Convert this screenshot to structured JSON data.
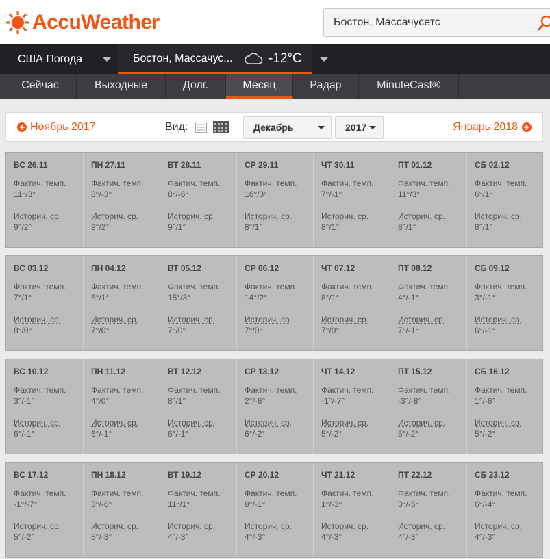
{
  "brand": {
    "name": "AccuWeather",
    "color": "#f05514"
  },
  "search": {
    "value": "Бостон, Массачусетс"
  },
  "nav": {
    "country": "США Погода",
    "city": "Бостон, Массачус...",
    "temp": "-12°C",
    "tabs": [
      "Сейчас",
      "Выходные",
      "Долг.",
      "Месяц",
      "Радар",
      "MinuteCast®"
    ],
    "active_tab": "Месяц"
  },
  "month": {
    "prev": "Ноябрь 2017",
    "next": "Январь 2018",
    "view_label": "Вид:",
    "month_select": "Декабрь",
    "year_select": "2017"
  },
  "labels": {
    "actual": "Фактич. темп.",
    "historic": "Историч. ср."
  },
  "weeks": [
    [
      {
        "d": "ВС 26.11",
        "a": "11°/3°",
        "h": "9°/2°"
      },
      {
        "d": "ПН 27.11",
        "a": "8°/-3°",
        "h": "9°/2°"
      },
      {
        "d": "ВТ 28.11",
        "a": "8°/-6°",
        "h": "9°/1°"
      },
      {
        "d": "СР 29.11",
        "a": "16°/3°",
        "h": "8°/1°"
      },
      {
        "d": "ЧТ 30.11",
        "a": "7°/-1°",
        "h": "8°/1°"
      },
      {
        "d": "ПТ 01.12",
        "a": "11°/3°",
        "h": "8°/1°"
      },
      {
        "d": "СБ 02.12",
        "a": "6°/1°",
        "h": "8°/1°"
      }
    ],
    [
      {
        "d": "ВС 03.12",
        "a": "7°/1°",
        "h": "8°/0°"
      },
      {
        "d": "ПН 04.12",
        "a": "6°/1°",
        "h": "7°/0°"
      },
      {
        "d": "ВТ 05.12",
        "a": "15°/3°",
        "h": "7°/0°"
      },
      {
        "d": "СР 06.12",
        "a": "14°/2°",
        "h": "7°/0°"
      },
      {
        "d": "ЧТ 07.12",
        "a": "8°/1°",
        "h": "7°/0°"
      },
      {
        "d": "ПТ 08.12",
        "a": "4°/-1°",
        "h": "7°/-1°"
      },
      {
        "d": "СБ 09.12",
        "a": "3°/-1°",
        "h": "6°/-1°"
      }
    ],
    [
      {
        "d": "ВС 10.12",
        "a": "3°/-1°",
        "h": "6°/-1°"
      },
      {
        "d": "ПН 11.12",
        "a": "4°/0°",
        "h": "6°/-1°"
      },
      {
        "d": "ВТ 12.12",
        "a": "8°/1°",
        "h": "6°/-1°"
      },
      {
        "d": "СР 13.12",
        "a": "2°/-6°",
        "h": "6°/-2°"
      },
      {
        "d": "ЧТ 14.12",
        "a": "-1°/-7°",
        "h": "5°/-2°"
      },
      {
        "d": "ПТ 15.12",
        "a": "-3°/-8°",
        "h": "5°/-2°"
      },
      {
        "d": "СБ 16.12",
        "a": "1°/-6°",
        "h": "5°/-2°"
      }
    ],
    [
      {
        "d": "ВС 17.12",
        "a": "-1°/-7°",
        "h": "5°/-2°"
      },
      {
        "d": "ПН 18.12",
        "a": "3°/-6°",
        "h": "5°/-3°"
      },
      {
        "d": "ВТ 19.12",
        "a": "11°/1°",
        "h": "4°/-3°"
      },
      {
        "d": "СР 20.12",
        "a": "8°/-1°",
        "h": "4°/-3°"
      },
      {
        "d": "ЧТ 21.12",
        "a": "1°/-3°",
        "h": "4°/-3°"
      },
      {
        "d": "ПТ 22.12",
        "a": "3°/-5°",
        "h": "4°/-3°"
      },
      {
        "d": "СБ 23.12",
        "a": "6°/-4°",
        "h": "4°/-3°"
      }
    ]
  ]
}
